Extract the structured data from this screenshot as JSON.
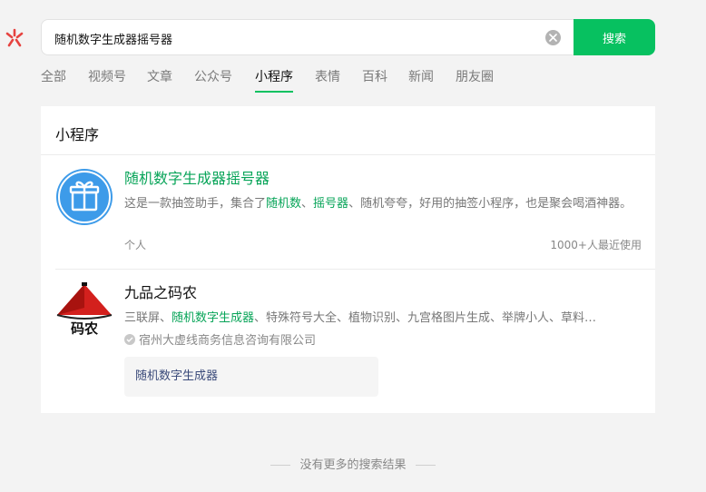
{
  "app": {
    "brand_color": "#07c160",
    "highlight_color": "#07a458",
    "logo": "wechat-search-star-icon"
  },
  "search": {
    "query": "随机数字生成器摇号器",
    "placeholder": "",
    "button_label": "搜索",
    "clear_icon": "close-circle-icon"
  },
  "tabs": [
    {
      "label": "全部",
      "active": false
    },
    {
      "label": "视频号",
      "active": false
    },
    {
      "label": "文章",
      "active": false
    },
    {
      "label": "公众号",
      "active": false
    },
    {
      "label": "小程序",
      "active": true
    },
    {
      "label": "表情",
      "active": false
    },
    {
      "label": "百科",
      "active": false
    },
    {
      "label": "新闻",
      "active": false
    },
    {
      "label": "朋友圈",
      "active": false
    }
  ],
  "panel": {
    "title": "小程序",
    "results": [
      {
        "title": "随机数字生成器摇号器",
        "avatar_icon": "gift-icon",
        "desc_parts": [
          "这是一款抽签助手，集合了",
          "随机数",
          "、",
          "摇号器",
          "、随机夸夸，好用的抽签小程序，也是聚会喝酒神器。"
        ],
        "meta_left": "个人",
        "meta_right": "1000+人最近使用"
      },
      {
        "title": "九品之码农",
        "avatar_icon": "coder-hat-logo-icon",
        "avatar_text": "码农",
        "desc_parts": [
          "三联屏、",
          "随机数字生成器",
          "、特殊符号大全、植物识别、九宫格图片生成、举牌小人、草料…"
        ],
        "verified_icon": "verified-check-icon",
        "company": "宿州大虚线商务信息咨询有限公司",
        "mini_card": "随机数字生成器"
      }
    ]
  },
  "footer": {
    "text": "没有更多的搜索结果"
  }
}
